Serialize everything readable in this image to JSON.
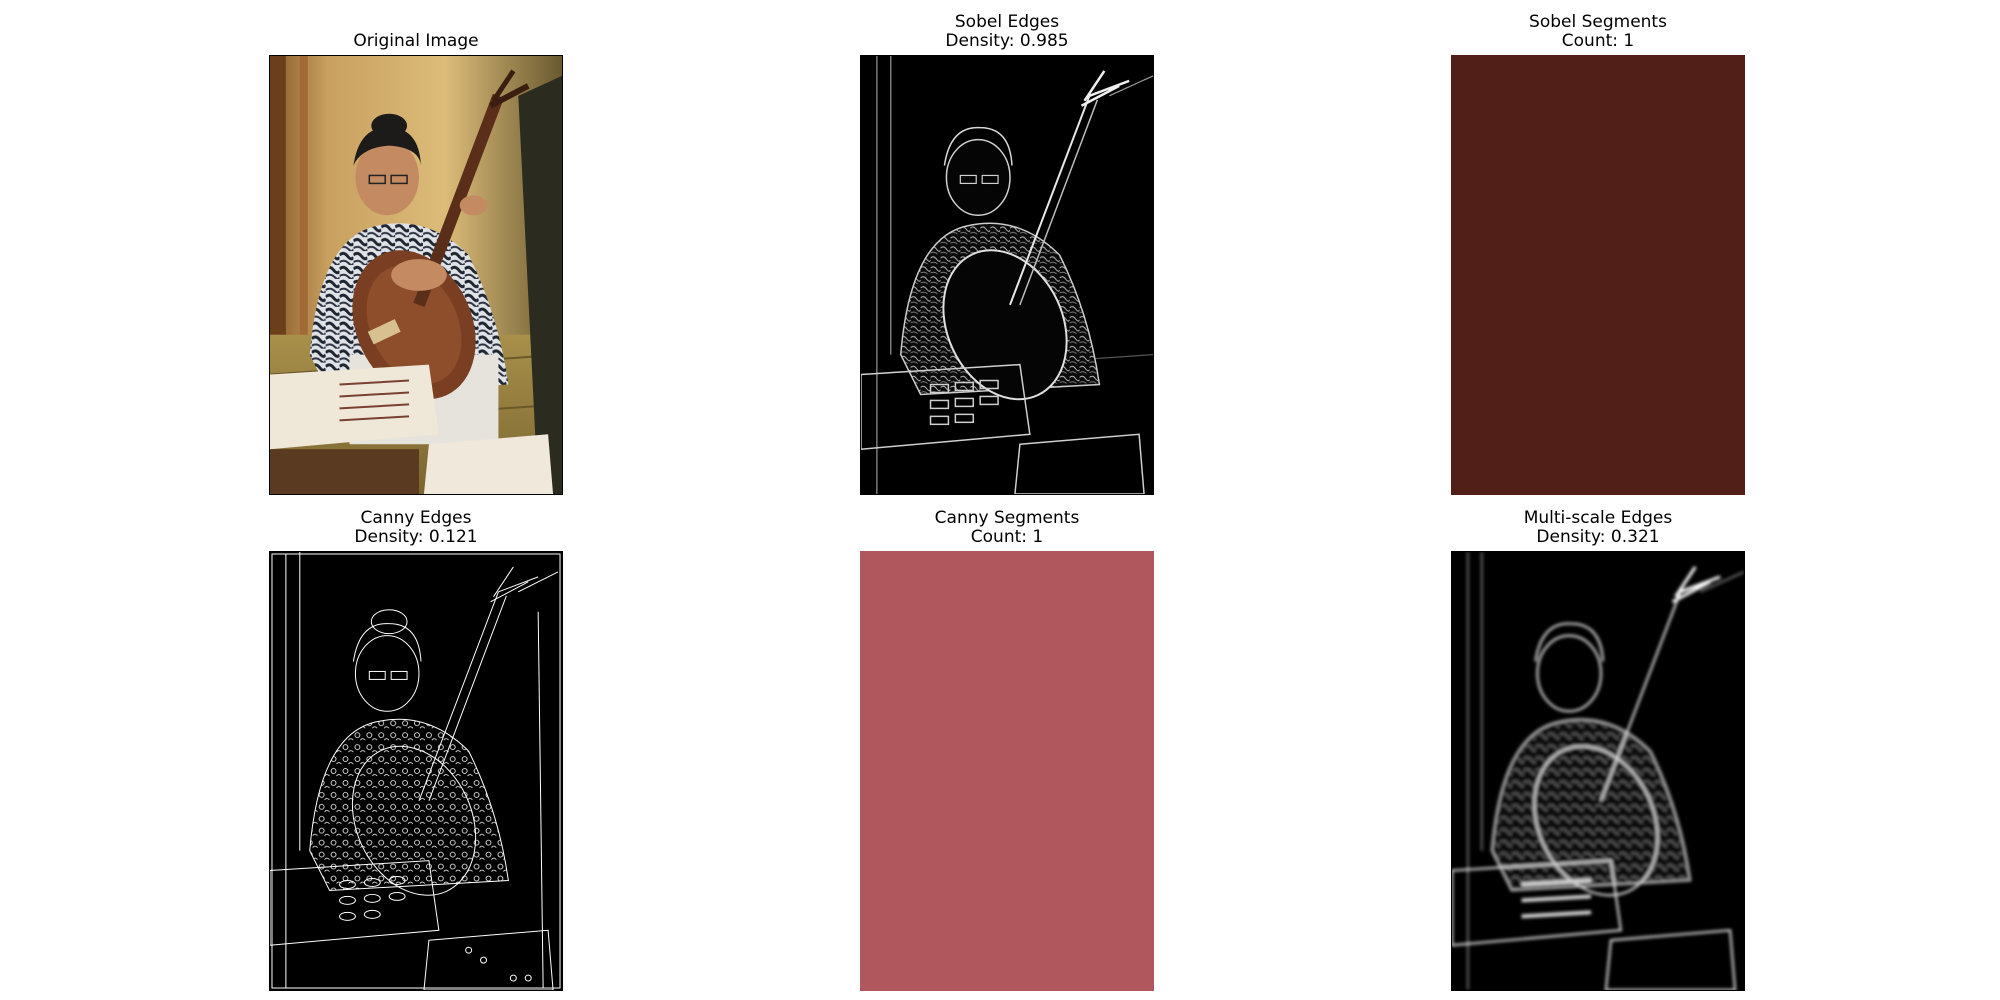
{
  "figure": {
    "panels": [
      {
        "key": "original",
        "title": "Original Image",
        "subtitle": ""
      },
      {
        "key": "sobel_edges",
        "title": "Sobel Edges",
        "subtitle": "Density: 0.985"
      },
      {
        "key": "sobel_segments",
        "title": "Sobel Segments",
        "subtitle": "Count: 1",
        "fill_color": "#521f18"
      },
      {
        "key": "canny_edges",
        "title": "Canny Edges",
        "subtitle": "Density: 0.121"
      },
      {
        "key": "canny_segments",
        "title": "Canny Segments",
        "subtitle": "Count: 1",
        "fill_color": "#b0565d"
      },
      {
        "key": "multiscale_edges",
        "title": "Multi-scale Edges",
        "subtitle": "Density: 0.321"
      }
    ]
  }
}
